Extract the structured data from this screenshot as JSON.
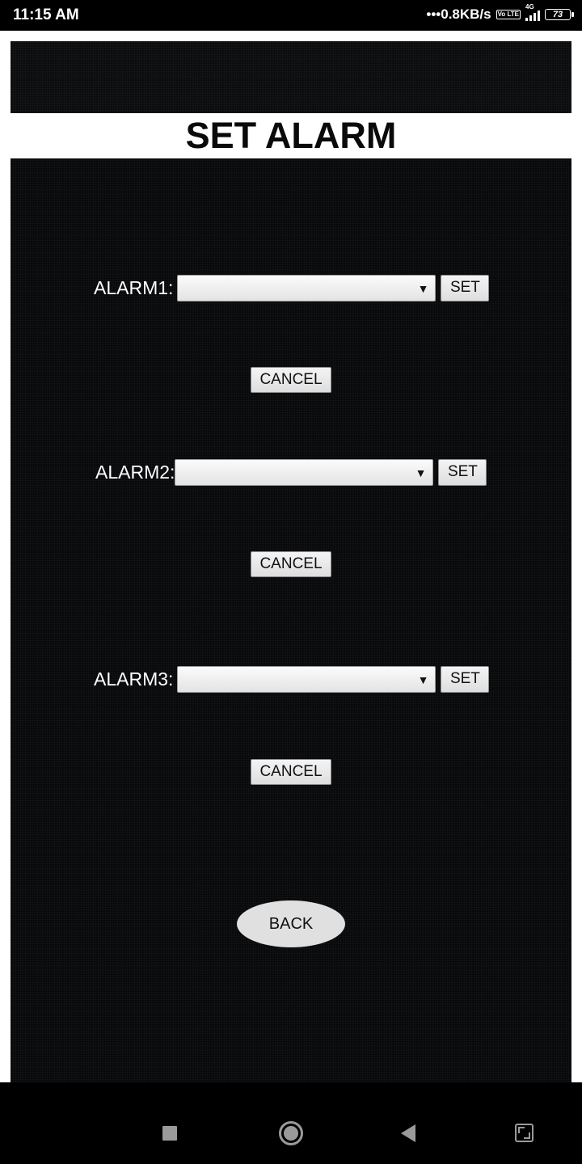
{
  "status_bar": {
    "time": "11:15 AM",
    "network_speed": "0.8KB/s",
    "volte_badge": "Vo LTE",
    "network_type": "4G",
    "battery_level": "73",
    "icons": [
      "dots-icon",
      "volte-icon",
      "signal-icon",
      "battery-icon"
    ]
  },
  "page": {
    "title": "SET ALARM"
  },
  "alarms": [
    {
      "label": "ALARM1:",
      "selected_value": "",
      "set_label": "SET",
      "cancel_label": "CANCEL"
    },
    {
      "label": "ALARM2:",
      "selected_value": "",
      "set_label": "SET",
      "cancel_label": "CANCEL"
    },
    {
      "label": "ALARM3:",
      "selected_value": "",
      "set_label": "SET",
      "cancel_label": "CANCEL"
    }
  ],
  "dropdown_arrow": "▼",
  "back_button": {
    "label": "BACK"
  },
  "nav_bar": {
    "icons": [
      "recents-square-icon",
      "home-circle-icon",
      "back-triangle-icon",
      "expand-screen-icon"
    ]
  },
  "colors": {
    "panel_background": "#08090a",
    "button_background": "#e0e0e0",
    "label_text": "#ffffff"
  }
}
